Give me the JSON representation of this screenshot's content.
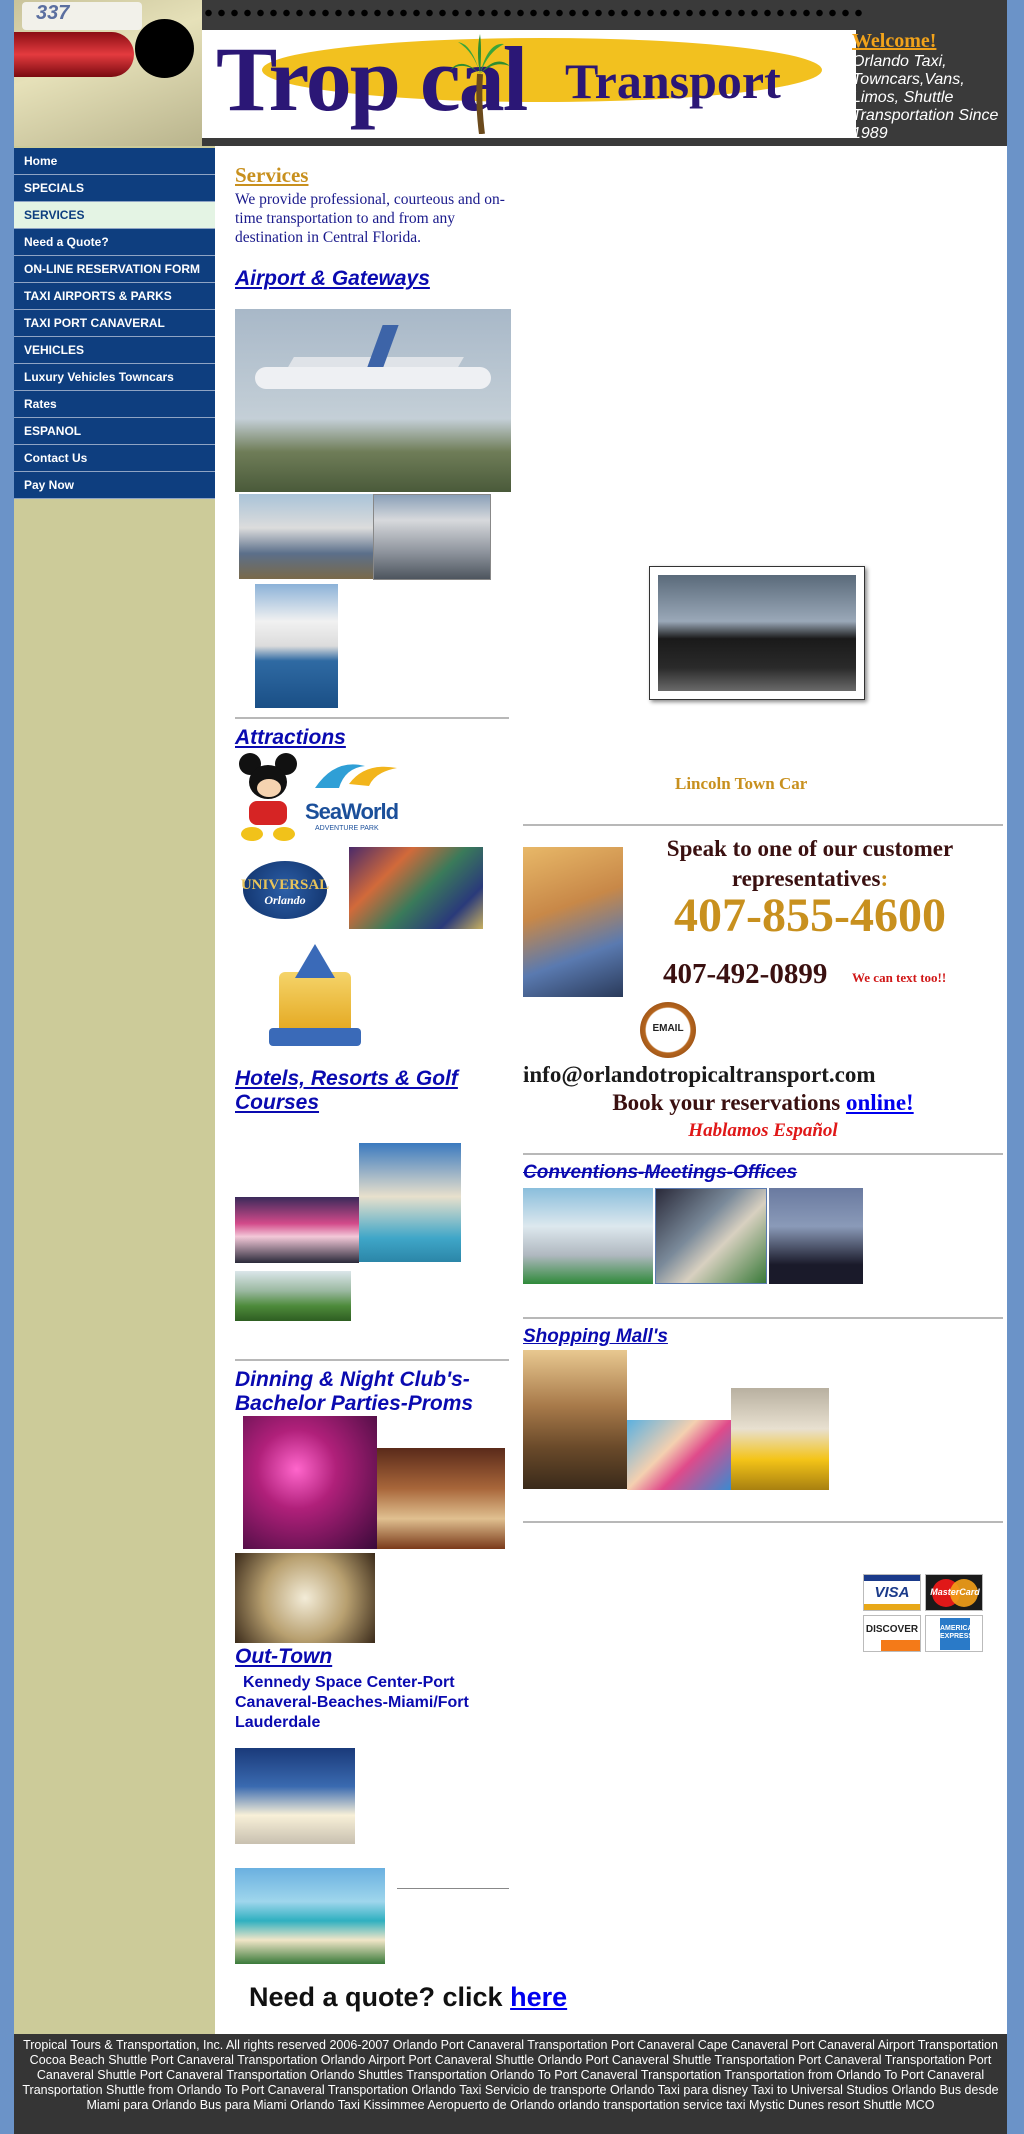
{
  "header": {
    "plate": "337",
    "logo_main": "Trop  cal",
    "logo_sub": "Transport",
    "welcome_title": "Welcome!",
    "welcome_text": "Orlando Taxi, Towncars,Vans, Limos, Shuttle Transportation Since 1989"
  },
  "nav": [
    {
      "label": "Home"
    },
    {
      "label": "SPECIALS"
    },
    {
      "label": "SERVICES"
    },
    {
      "label": "Need a Quote?"
    },
    {
      "label": "ON-LINE RESERVATION FORM"
    },
    {
      "label": "TAXI AIRPORTS & PARKS"
    },
    {
      "label": "TAXI PORT CANAVERAL"
    },
    {
      "label": "VEHICLES"
    },
    {
      "label": "Luxury Vehicles Towncars"
    },
    {
      "label": "Rates"
    },
    {
      "label": "ESPANOL"
    },
    {
      "label": "Contact Us"
    },
    {
      "label": "Pay Now"
    }
  ],
  "main": {
    "services_title": "Services",
    "services_text": "We provide professional, courteous and on-time transportation to and from any destination in Central Florida.",
    "airport_heading": "Airport  & Gateways",
    "attractions_heading": "Attractions",
    "seaworld": "SeaWorld",
    "seaworld_sub": "ADVENTURE PARK",
    "universal": "UNIVERSAL",
    "universal_sub": "Orlando",
    "hotels_heading": "Hotels, Resorts & Golf Courses",
    "dining_heading": "Dinning & Night Club's-Bachelor Parties-Proms",
    "outtown_heading": "Out-Town",
    "outtown_text": "Kennedy Space Center-Port Canaveral-Beaches-Miami/Fort Lauderdale",
    "car_caption": "Lincoln Town Car",
    "speak_text": "Speak to one of our customer representatives",
    "speak_colon": ":",
    "phone_main": "407-855-4600",
    "phone_alt": "407-492-0899",
    "text_note": "We can text too!!",
    "email_badge": "EMAIL",
    "email_address": "info@orlandotropicaltransport.com",
    "book_text": "Book your reservations",
    "book_link": "online!",
    "hablamos": "Hablamos Español",
    "conventions_heading": "Conventions-Meetings-Offices",
    "shopping_heading": "Shopping Mall's",
    "cards": [
      "VISA",
      "MasterCard",
      "DISCOVER",
      "AMERICAN EXPRESS"
    ],
    "quote_text": "Need a quote? click",
    "quote_link": "here"
  },
  "footer": {
    "text": "Tropical Tours & Transportation, Inc. All rights reserved 2006-2007 Orlando Port Canaveral Transportation Port Canaveral Cape Canaveral Port Canaveral Airport Transportation Cocoa Beach Shuttle Port Canaveral Transportation Orlando Airport Port Canaveral Shuttle Orlando Port Canaveral Shuttle Transportation Port Canaveral Transportation Port Canaveral Shuttle Port Canaveral Transportation Orlando Shuttles Transportation Orlando To Port Canaveral Transportation Transportation from Orlando To Port Canaveral Transportation Shuttle from Orlando To Port Canaveral Transportation Orlando Taxi Servicio de transporte Orlando Taxi para disney Taxi to Universal Studios Orlando Bus desde Miami para Orlando Bus para Miami Orlando Taxi Kissimmee Aeropuerto de Orlando orlando transportation service taxi Mystic Dunes resort Shuttle MCO"
  },
  "colors": {
    "nav_bg": "#0e3e7f",
    "sidebar_bg": "#cccb99",
    "page_bg": "#6b93c8",
    "accent_gold": "#c8901e",
    "heading_blue": "#0a0ab0"
  }
}
